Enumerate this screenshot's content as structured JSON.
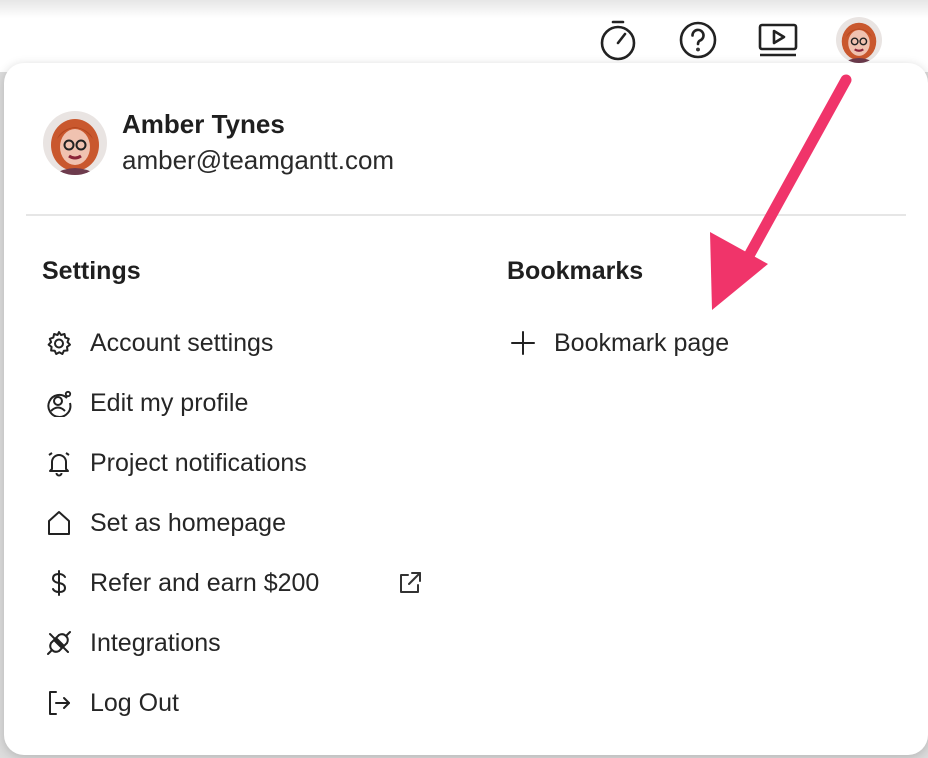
{
  "topbar": {
    "icons": [
      "stopwatch-icon",
      "help-icon",
      "video-tutorial-icon"
    ]
  },
  "profile": {
    "name": "Amber Tynes",
    "email": "amber@teamgantt.com"
  },
  "settings": {
    "title": "Settings",
    "items": [
      {
        "label": "Account settings",
        "icon": "gear-icon"
      },
      {
        "label": "Edit my profile",
        "icon": "user-gear-icon"
      },
      {
        "label": "Project notifications",
        "icon": "bell-icon"
      },
      {
        "label": "Set as homepage",
        "icon": "home-icon"
      },
      {
        "label": "Refer and earn $200",
        "icon": "dollar-icon"
      },
      {
        "label": "Integrations",
        "icon": "plug-icon"
      },
      {
        "label": "Log Out",
        "icon": "logout-icon"
      }
    ]
  },
  "bookmarks": {
    "title": "Bookmarks",
    "add_label": "Bookmark page",
    "add_icon": "plus-icon"
  },
  "colors": {
    "annotation_arrow": "#f0346a",
    "text": "#1f1f1f",
    "divider": "#e6e6e6"
  }
}
